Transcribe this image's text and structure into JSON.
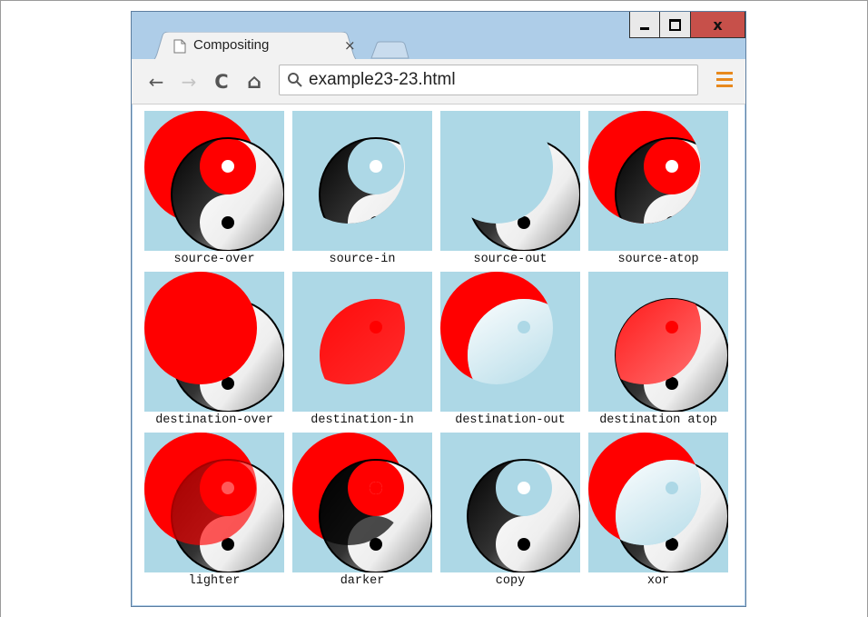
{
  "window": {
    "controls": {
      "minimize": "▁",
      "maximize": "☐",
      "close": "x"
    }
  },
  "tab": {
    "title": "Compositing",
    "close": "×"
  },
  "toolbar": {
    "back": "←",
    "forward": "→",
    "reload": "C",
    "home": "⌂",
    "url": "example23-23.html"
  },
  "icons": {
    "tab_page": "page-icon",
    "omnibox": "search-icon",
    "menu": "hamburger-menu-icon"
  },
  "colors": {
    "canvas_bg": "#add8e6",
    "red": "#ff0000",
    "menu_accent": "#e8891d",
    "titlebar": "#aecde8",
    "close_button": "#c7504a"
  },
  "demos": [
    {
      "label": "source-over",
      "op": "source-over"
    },
    {
      "label": "source-in",
      "op": "source-in"
    },
    {
      "label": "source-out",
      "op": "source-out"
    },
    {
      "label": "source-atop",
      "op": "source-atop"
    },
    {
      "label": "destination-over",
      "op": "destination-over"
    },
    {
      "label": "destination-in",
      "op": "destination-in"
    },
    {
      "label": "destination-out",
      "op": "destination-out"
    },
    {
      "label": "destination atop",
      "op": "destination-atop"
    },
    {
      "label": "lighter",
      "op": "lighter"
    },
    {
      "label": "darker",
      "op": "darker"
    },
    {
      "label": "copy",
      "op": "copy"
    },
    {
      "label": "xor",
      "op": "xor"
    }
  ]
}
